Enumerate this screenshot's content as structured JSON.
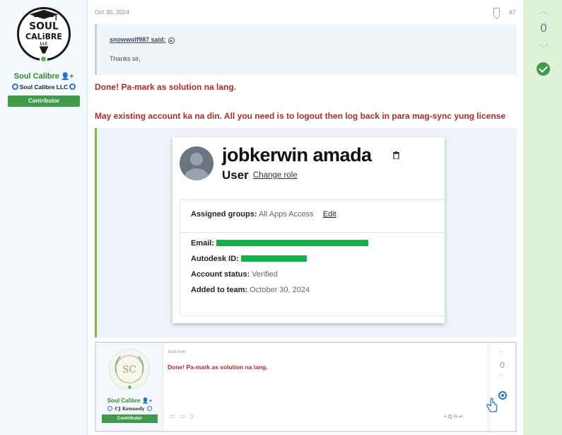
{
  "author": {
    "logo_text": [
      "SOUL",
      "CALiBRE",
      "LLC"
    ],
    "username": "Soul Calibre",
    "organization": "Soul Calibre LLC",
    "badge": "Contributor"
  },
  "post": {
    "date": "Oct 30, 2024",
    "number": "#7",
    "quote": {
      "author": "snowwolf987 said:",
      "text": "Thanks sir,"
    },
    "message_1": "Done! Pa-mark as solution na lang.",
    "message_2": "May existing account ka na din. All you need is to logout then log back in para mag-sync yung license"
  },
  "screenshot_card": {
    "name": "jobkerwin amada",
    "role": "User",
    "change_role": "Change role",
    "assigned_groups_label": "Assigned groups:",
    "assigned_groups_value": "All Apps Access",
    "edit": "Edit",
    "email_label": "Email:",
    "autodesk_label": "Autodesk ID:",
    "status_label": "Account status:",
    "status_value": "Verified",
    "added_label": "Added to team:",
    "added_value": "October 30, 2024"
  },
  "screenshot_post": {
    "logo_text": "SC",
    "username": "Soul Calibre",
    "organization": "CJ Kennedy",
    "badge": "Contributor",
    "date": "Just now",
    "message": "Done! Pa-mark as solution na lang.",
    "tools": "+ Q   ⅔ ↩",
    "score": "0"
  },
  "votes": {
    "score": "0",
    "solution": true
  },
  "colors": {
    "accent_green": "#3f9a4a",
    "message_red": "#b02b2b",
    "vote_bg": "#dff2d8",
    "redaction": "#14b04c"
  }
}
